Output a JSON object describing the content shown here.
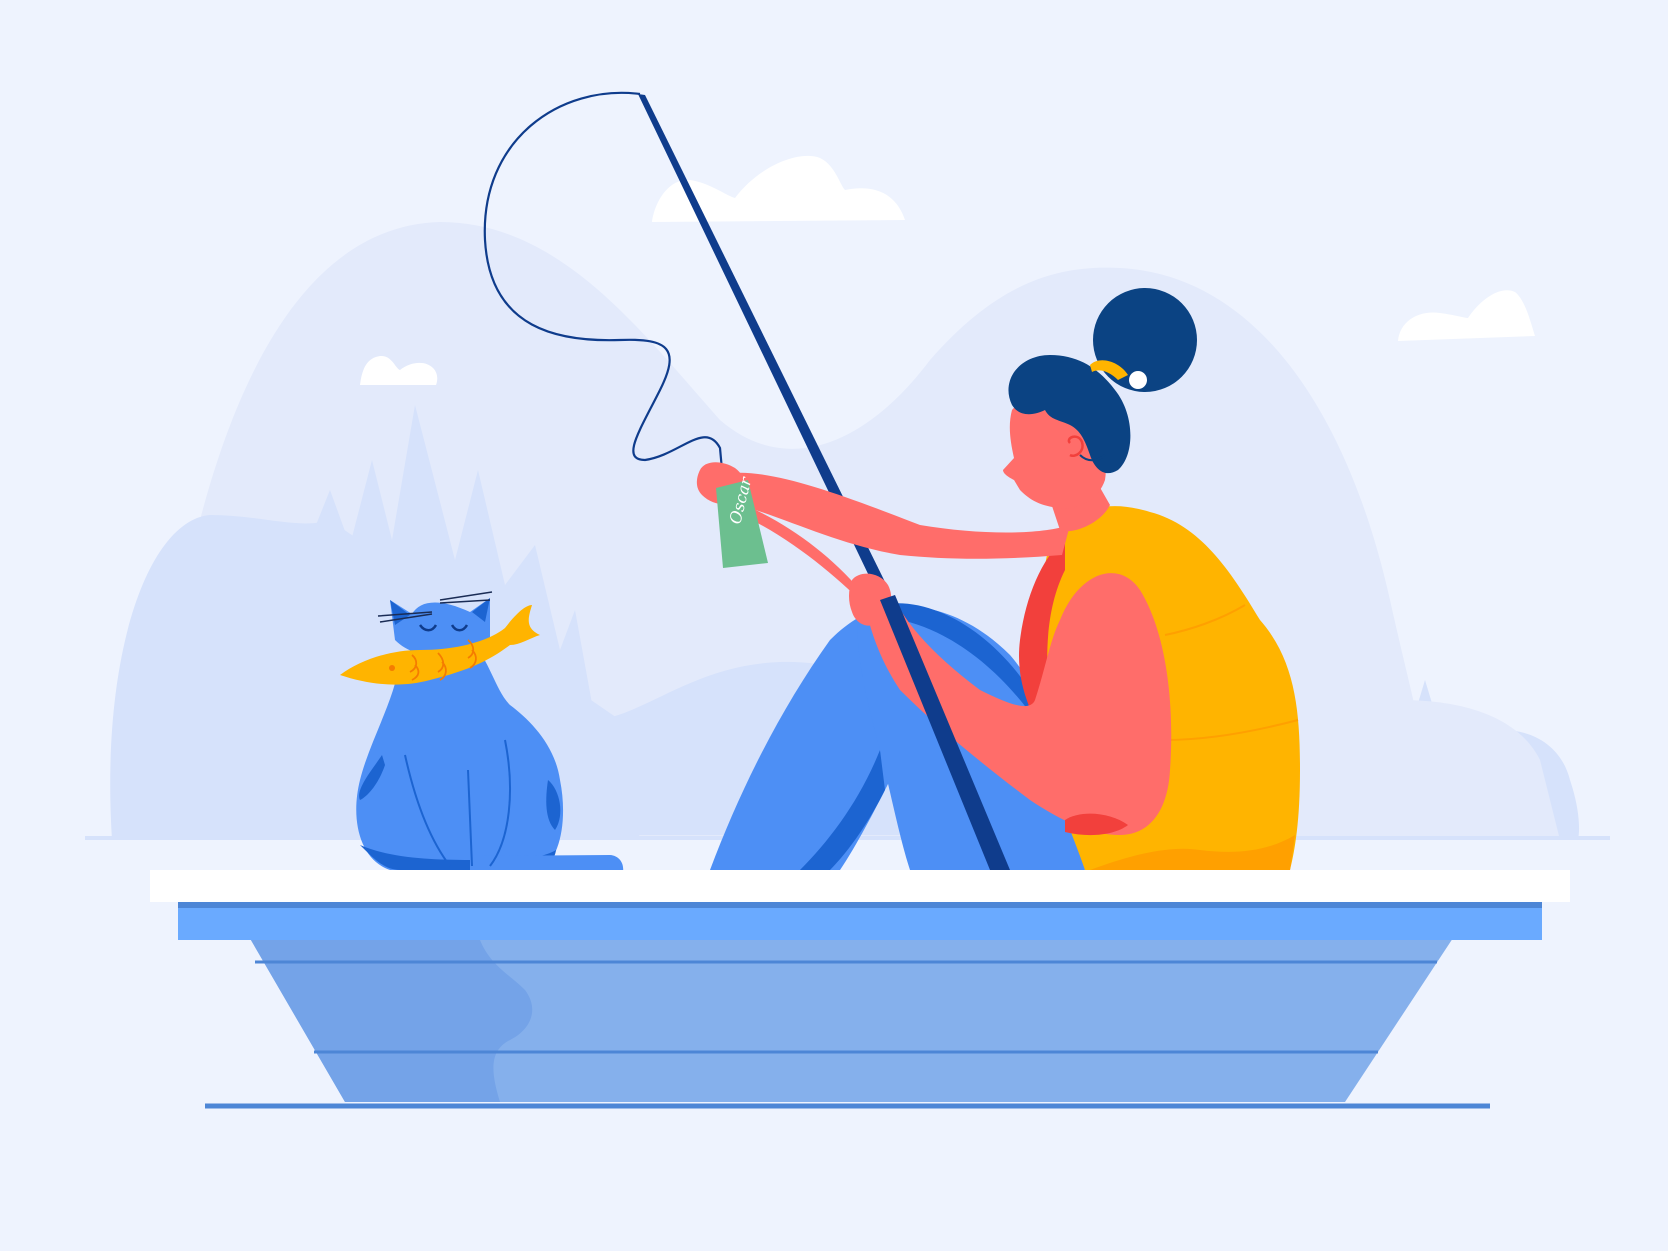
{
  "scene": {
    "description_icon": "woman-fishing-with-cat-in-boat",
    "tag_lettering": "Oscar",
    "colors": {
      "background": "#eef3fe",
      "mountain_far": "#e3eafb",
      "mountain_near": "#d6e2fb",
      "cloud": "#ffffff",
      "hair": "#0b4383",
      "skin": "#ff6d6a",
      "skin_shadow": "#f2403c",
      "top": "#ffb400",
      "top_shadow": "#ffa000",
      "pants": "#4d8ff5",
      "pants_shadow": "#1c64d1",
      "rod": "#0f3c8c",
      "cat": "#4d8ff5",
      "cat_shadow": "#1c64d1",
      "fish": "#ffb400",
      "fish_lines": "#f57c00",
      "tag": "#6cbf8f",
      "boat_rim": "#ffffff",
      "boat_band": "#6aaaff",
      "boat_hull": "#85b0ec",
      "boat_hull_shadow": "#74a3e8",
      "boat_lines": "#4d86d6",
      "water_line": "#4d86d6"
    }
  }
}
